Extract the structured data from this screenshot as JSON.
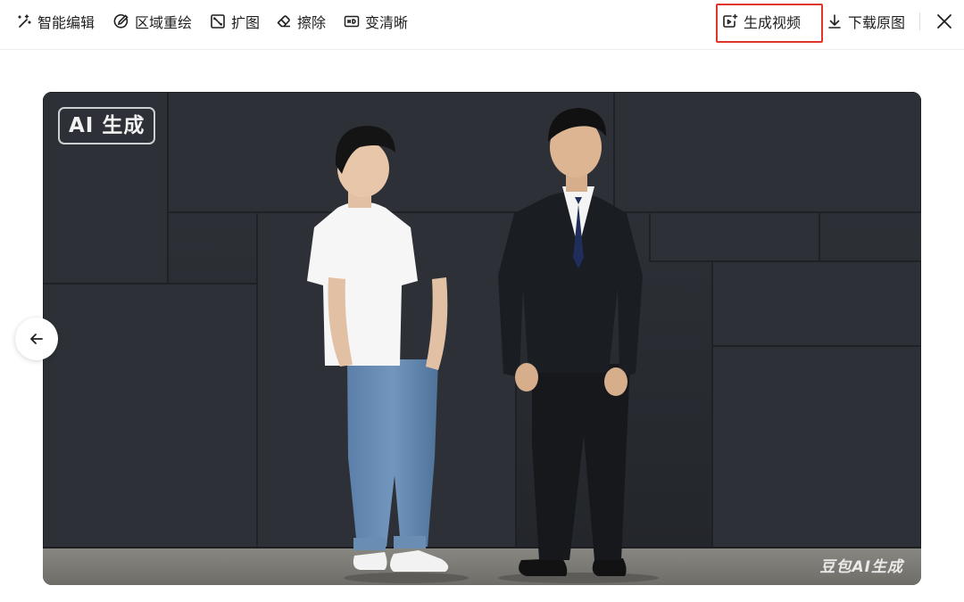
{
  "toolbar": {
    "smart_edit": "智能编辑",
    "region_repaint": "区域重绘",
    "expand": "扩图",
    "erase": "擦除",
    "enhance": "变清晰",
    "generate_video": "生成视频",
    "download_original": "下载原图"
  },
  "image": {
    "badge": "AI 生成",
    "watermark": "豆包AI生成"
  },
  "colors": {
    "highlight": "#e0362c",
    "wall": "#2b2f35",
    "floor": "#7d7b76"
  },
  "icons": [
    "magic-wand-icon",
    "region-repaint-icon",
    "expand-icon",
    "eraser-icon",
    "hd-icon",
    "video-spark-icon",
    "download-icon",
    "close-icon",
    "arrow-left-icon"
  ]
}
